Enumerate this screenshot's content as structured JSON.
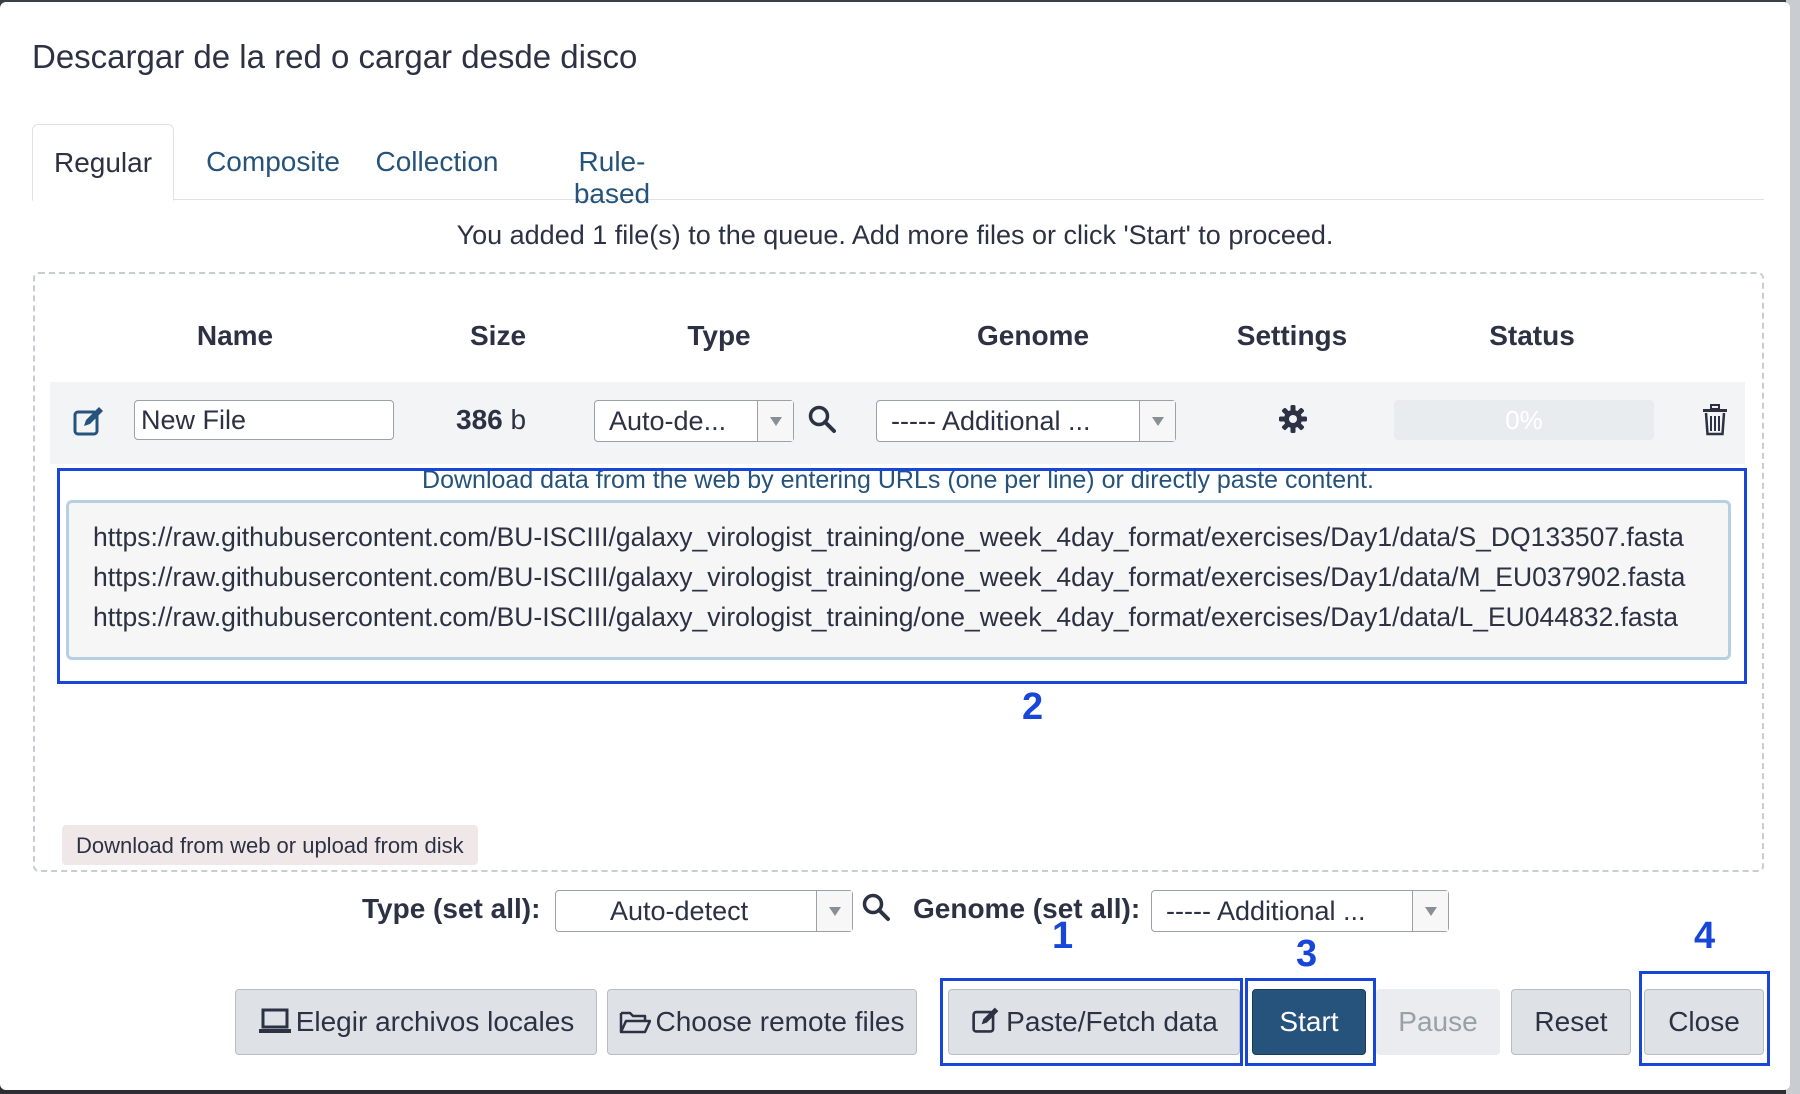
{
  "modal": {
    "title": "Descargar de la red o cargar desde disco"
  },
  "tabs": [
    {
      "label": "Regular",
      "active": true
    },
    {
      "label": "Composite",
      "active": false
    },
    {
      "label": "Collection",
      "active": false
    },
    {
      "label": "Rule-based",
      "active": false
    }
  ],
  "queue_message": "You added 1 file(s) to the queue. Add more files or click 'Start' to proceed.",
  "table": {
    "headers": [
      "Name",
      "Size",
      "Type",
      "Genome",
      "Settings",
      "Status"
    ]
  },
  "file_row": {
    "name": "New File",
    "size_value": "386",
    "size_unit": "b",
    "type_value": "Auto-de...",
    "genome_value": "----- Additional ...",
    "status_progress": "0%"
  },
  "paste": {
    "hint": "Download data from the web by entering URLs (one per line) or directly paste content.",
    "lines": [
      "https://raw.githubusercontent.com/BU-ISCIII/galaxy_virologist_training/one_week_4day_format/exercises/Day1/data/S_DQ133507.fasta",
      "https://raw.githubusercontent.com/BU-ISCIII/galaxy_virologist_training/one_week_4day_format/exercises/Day1/data/M_EU037902.fasta",
      "https://raw.githubusercontent.com/BU-ISCIII/galaxy_virologist_training/one_week_4day_format/exercises/Day1/data/L_EU044832.fasta"
    ]
  },
  "tooltip": "Download from web or upload from disk",
  "set_all": {
    "type_label": "Type (set all):",
    "type_value": "Auto-detect",
    "genome_label": "Genome (set all):",
    "genome_value": "----- Additional ..."
  },
  "buttons": {
    "local": "Elegir archivos locales",
    "remote": "Choose remote files",
    "paste": "Paste/Fetch data",
    "start": "Start",
    "pause": "Pause",
    "reset": "Reset",
    "close": "Close"
  },
  "annotations": [
    "1",
    "2",
    "3",
    "4"
  ],
  "colors": {
    "accent": "#25537b",
    "annotation": "#1746d8"
  }
}
